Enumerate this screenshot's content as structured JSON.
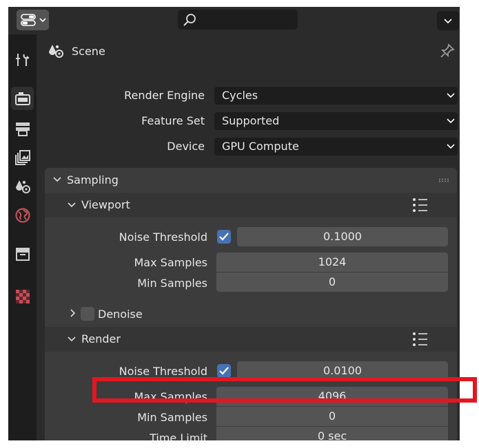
{
  "properties": {
    "context_title": "Scene",
    "render_engine": {
      "label": "Render Engine",
      "value": "Cycles"
    },
    "feature_set": {
      "label": "Feature Set",
      "value": "Supported"
    },
    "device": {
      "label": "Device",
      "value": "GPU Compute"
    }
  },
  "sampling": {
    "title": "Sampling",
    "viewport": {
      "title": "Viewport",
      "noise_threshold_label": "Noise Threshold",
      "noise_threshold_value": "0.1000",
      "max_samples_label": "Max Samples",
      "max_samples_value": "1024",
      "min_samples_label": "Min Samples",
      "min_samples_value": "0"
    },
    "denoise_label": "Denoise",
    "render": {
      "title": "Render",
      "noise_threshold_label": "Noise Threshold",
      "noise_threshold_value": "0.0100",
      "max_samples_label": "Max Samples",
      "max_samples_value": "4096",
      "min_samples_label": "Min Samples",
      "min_samples_value": "0",
      "time_limit_label": "Time Limit",
      "time_limit_value": "0 sec"
    }
  },
  "colors": {
    "accent_checkbox": "#4772b3",
    "highlight_box": "#e31720",
    "world_tab": "#c25459",
    "texture_tab": "#cc4c55"
  }
}
